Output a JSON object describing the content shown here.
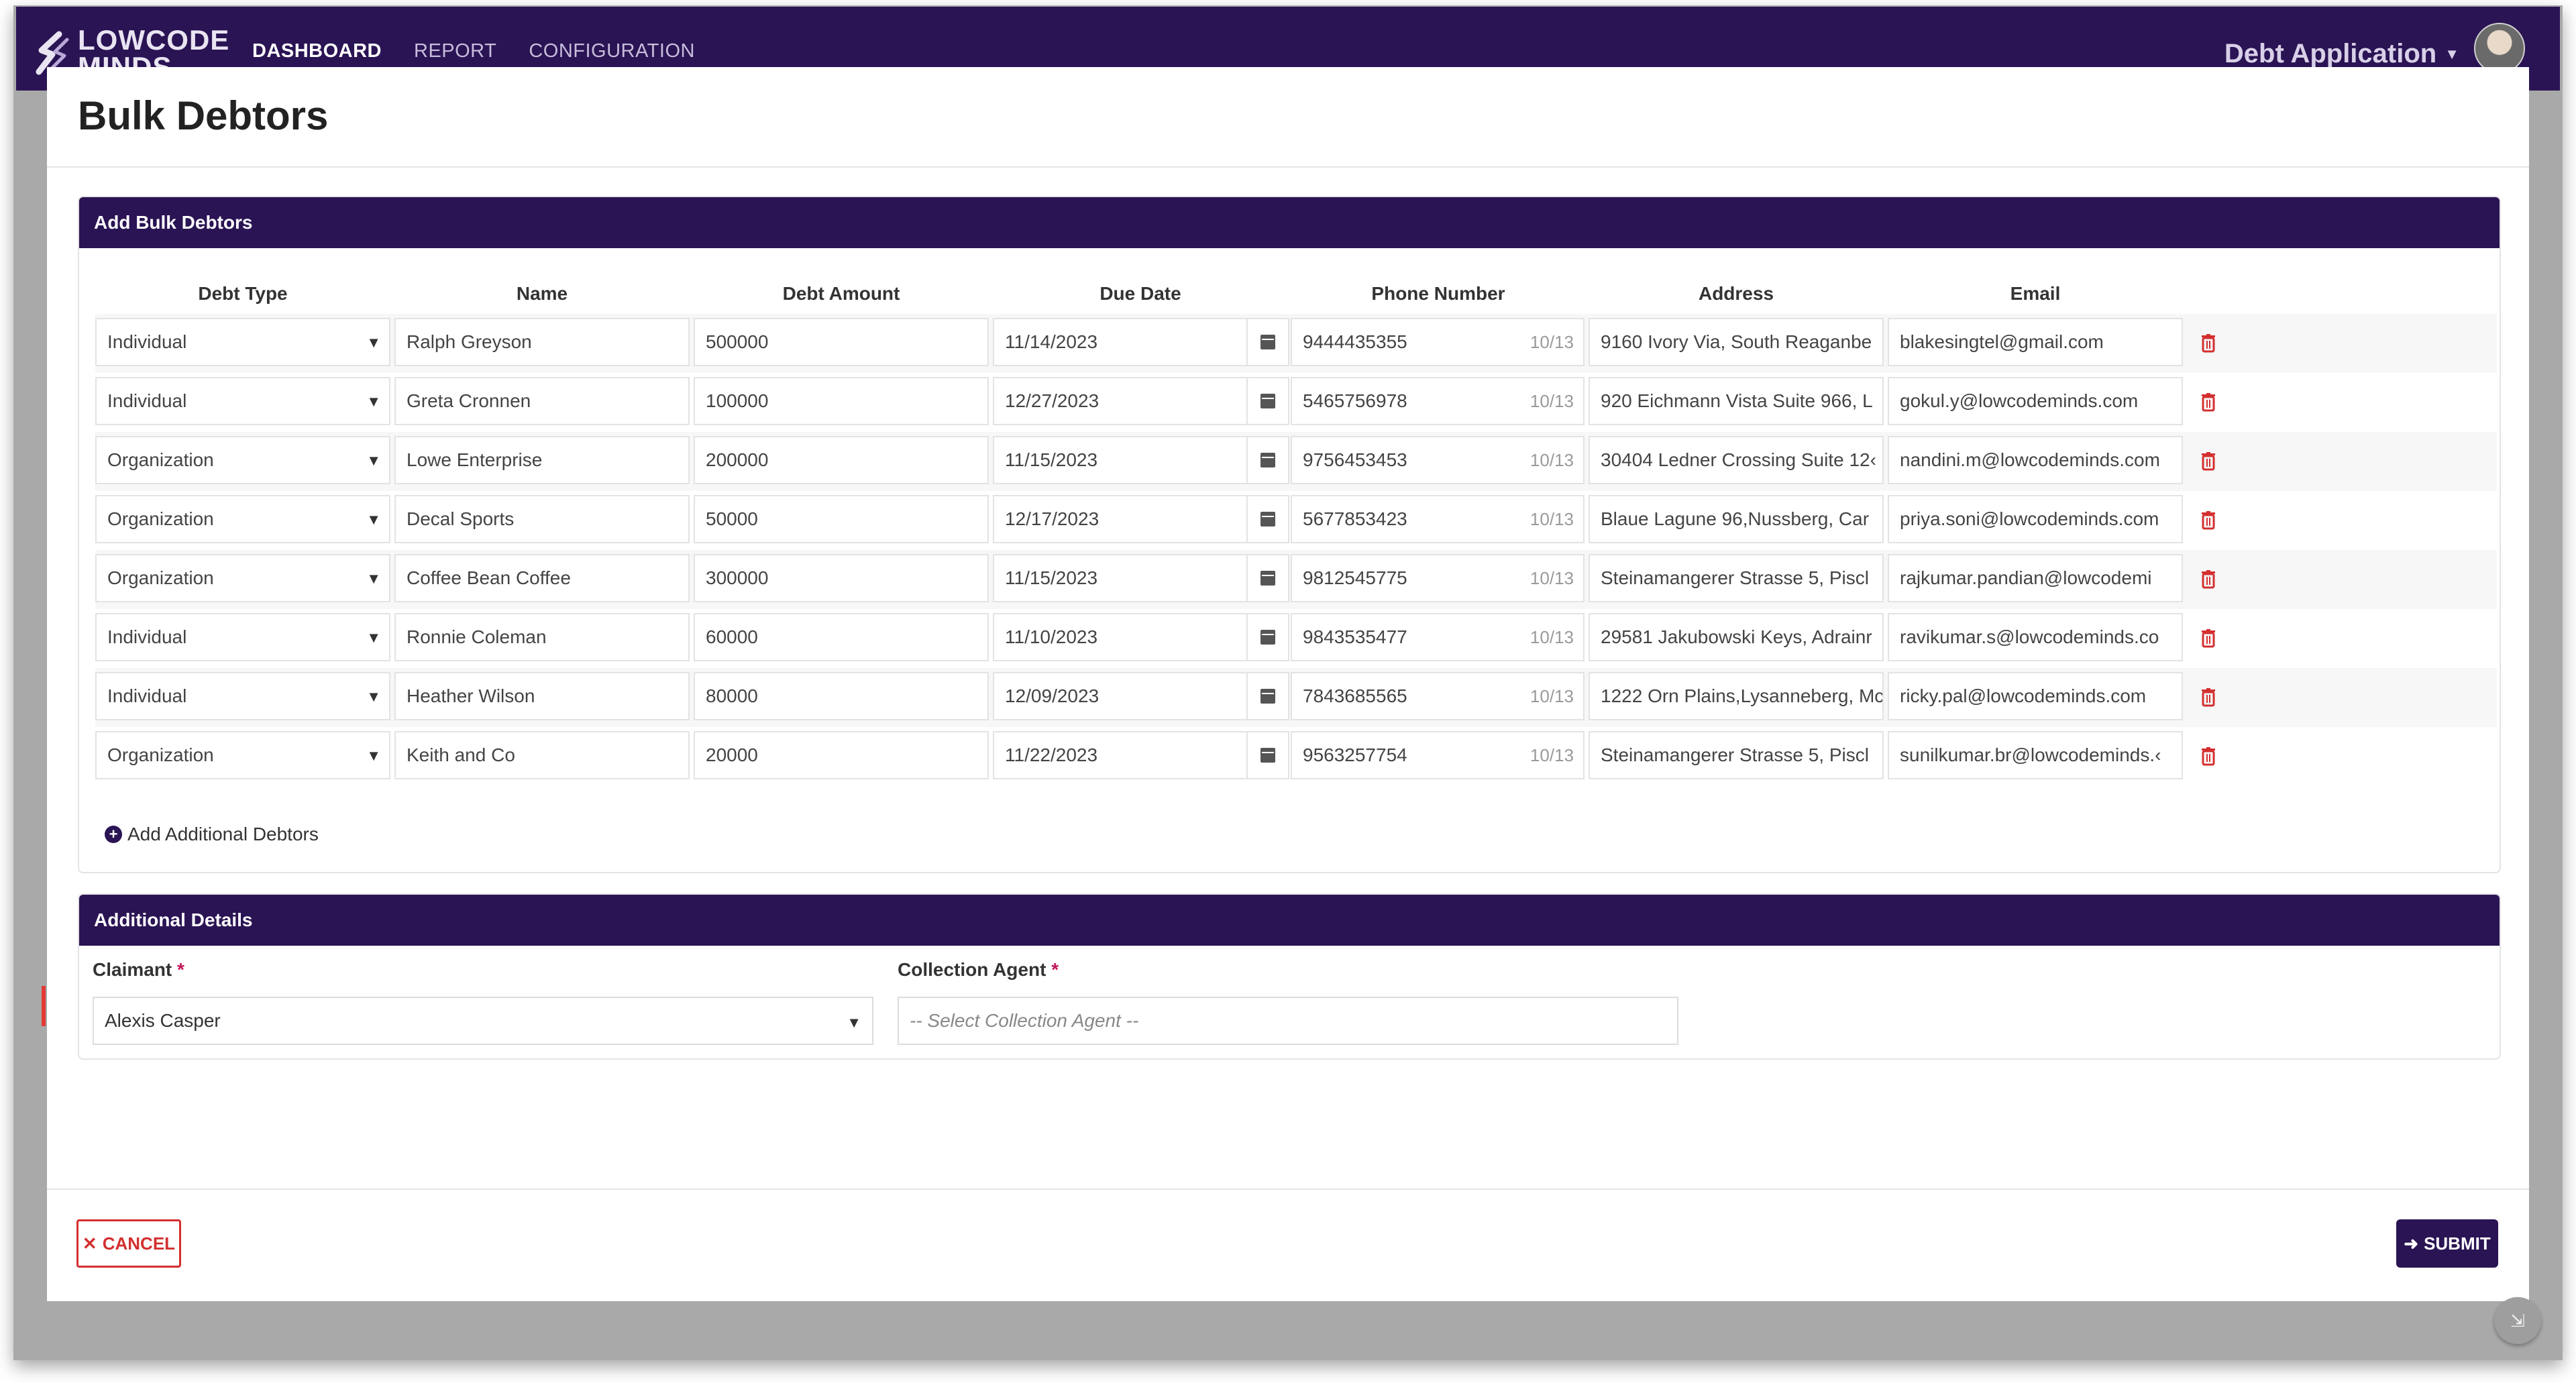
{
  "header": {
    "logo_text": "LOWCODE MINDS",
    "nav": [
      "DASHBOARD",
      "REPORT",
      "CONFIGURATION"
    ],
    "app_name": "Debt Application"
  },
  "modal": {
    "title": "Bulk Debtors",
    "bulk_section_title": "Add Bulk Debtors",
    "columns": [
      "Debt Type",
      "Name",
      "Debt Amount",
      "Due Date",
      "Phone Number",
      "Address",
      "Email"
    ],
    "rows": [
      {
        "debt_type": "Individual",
        "name": "Ralph Greyson",
        "amount": "500000",
        "due_date": "11/14/2023",
        "phone": "9444435355",
        "counter": "10/13",
        "address": "9160 Ivory Via, South Reaganbe",
        "email": "blakesingtel@gmail.com"
      },
      {
        "debt_type": "Individual",
        "name": "Greta Cronnen",
        "amount": "100000",
        "due_date": "12/27/2023",
        "phone": "5465756978",
        "counter": "10/13",
        "address": "920 Eichmann Vista Suite 966, L",
        "email": "gokul.y@lowcodeminds.com"
      },
      {
        "debt_type": "Organization",
        "name": "Lowe Enterprise",
        "amount": "200000",
        "due_date": "11/15/2023",
        "phone": "9756453453",
        "counter": "10/13",
        "address": "30404 Ledner Crossing Suite 12‹",
        "email": "nandini.m@lowcodeminds.com"
      },
      {
        "debt_type": "Organization",
        "name": "Decal Sports",
        "amount": "50000",
        "due_date": "12/17/2023",
        "phone": "5677853423",
        "counter": "10/13",
        "address": "Blaue Lagune 96,Nussberg, Car",
        "email": "priya.soni@lowcodeminds.com"
      },
      {
        "debt_type": "Organization",
        "name": "Coffee Bean Coffee",
        "amount": "300000",
        "due_date": "11/15/2023",
        "phone": "9812545775",
        "counter": "10/13",
        "address": "Steinamangerer Strasse 5, Piscl",
        "email": "rajkumar.pandian@lowcodemi"
      },
      {
        "debt_type": "Individual",
        "name": "Ronnie Coleman",
        "amount": "60000",
        "due_date": "11/10/2023",
        "phone": "9843535477",
        "counter": "10/13",
        "address": "29581 Jakubowski Keys, Adrainr",
        "email": "ravikumar.s@lowcodeminds.co"
      },
      {
        "debt_type": "Individual",
        "name": "Heather Wilson",
        "amount": "80000",
        "due_date": "12/09/2023",
        "phone": "7843685565",
        "counter": "10/13",
        "address": "1222 Orn Plains,Lysanneberg, Mc",
        "email": "ricky.pal@lowcodeminds.com"
      },
      {
        "debt_type": "Organization",
        "name": "Keith and Co",
        "amount": "20000",
        "due_date": "11/22/2023",
        "phone": "9563257754",
        "counter": "10/13",
        "address": "Steinamangerer Strasse 5, Piscl",
        "email": "sunilkumar.br@lowcodeminds.‹"
      }
    ],
    "add_more_label": "Add Additional Debtors",
    "details_section_title": "Additional Details",
    "claimant_label": "Claimant",
    "claimant_value": "Alexis Casper",
    "agent_label": "Collection Agent",
    "agent_placeholder": "-- Select Collection Agent --",
    "required_mark": "*",
    "cancel_label": "CANCEL",
    "submit_label": "SUBMIT"
  },
  "colors": {
    "brand_purple": "#2a1454",
    "danger_red": "#d32f2f"
  }
}
